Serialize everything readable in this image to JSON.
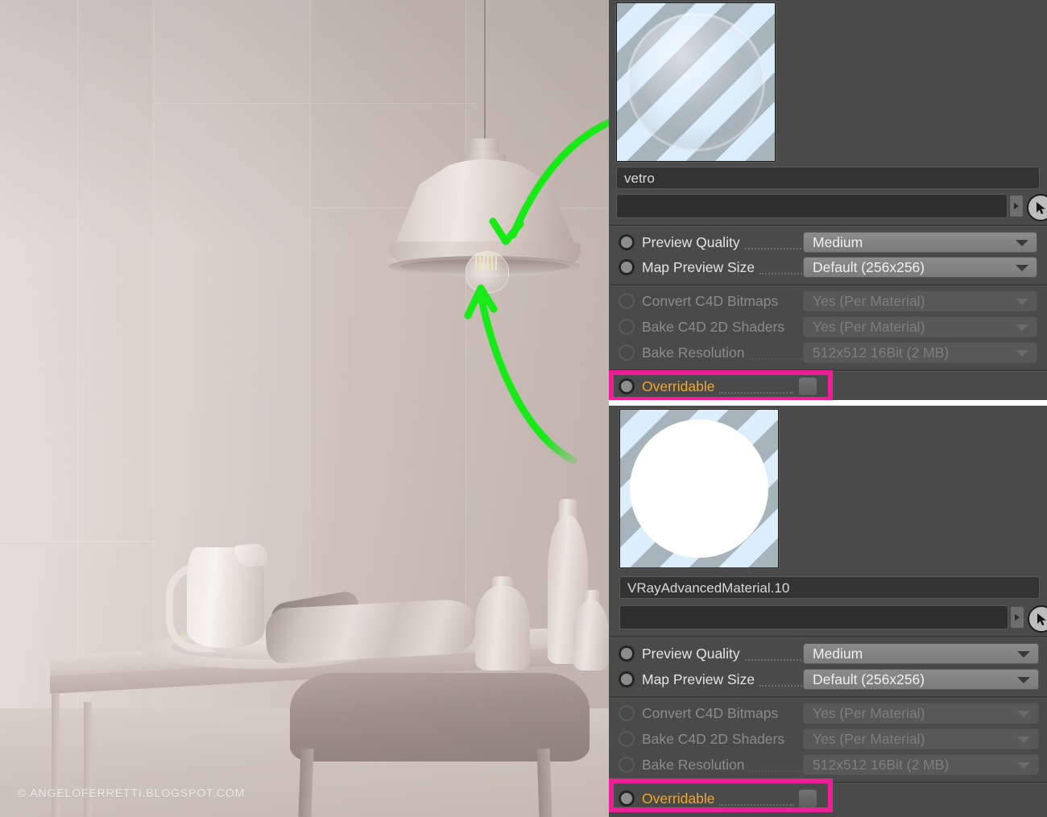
{
  "render": {
    "watermark": "© ANGELOFERRETTI.BLOGSPOT.COM",
    "scene_description": "Grey clay-render interior: pendant lamp with glass bulb over a table with pitcher, plate, cloth and vases, chair in foreground",
    "annotations": [
      {
        "name": "arrow-to-lamp-glass",
        "color": "#1eea1e",
        "from": "material-swatch-vetro",
        "to": "lamp-bulb-glass"
      },
      {
        "name": "arrow-to-bulb",
        "color": "#1eea1e",
        "from": "material-panel-vray-advanced",
        "to": "lamp-bulb"
      }
    ]
  },
  "highlight_color": "#ed1e96",
  "accent_color": "#f0a830",
  "materials": [
    {
      "id": "vetro",
      "swatch": "glass-sphere-preview",
      "name_value": "vetro",
      "link_value": "",
      "cursor_icon": "pick-cursor-icon",
      "properties": [
        {
          "label": "Preview Quality",
          "value": "Medium",
          "enabled": true,
          "control": "dropdown"
        },
        {
          "label": "Map Preview Size",
          "value": "Default (256x256)",
          "enabled": true,
          "control": "dropdown"
        },
        {
          "label": "Convert C4D Bitmaps",
          "value": "Yes (Per Material)",
          "enabled": false,
          "control": "dropdown"
        },
        {
          "label": "Bake C4D 2D Shaders",
          "value": "Yes (Per Material)",
          "enabled": false,
          "control": "dropdown"
        },
        {
          "label": "Bake Resolution",
          "value": "512x512   16Bit   (2 MB)",
          "enabled": false,
          "control": "dropdown"
        }
      ],
      "overridable": {
        "label": "Overridable",
        "checked": false,
        "highlighted": true
      }
    },
    {
      "id": "vray-advanced-material-10",
      "swatch": "white-sphere-preview",
      "name_value": "VRayAdvancedMaterial.10",
      "link_value": "",
      "cursor_icon": "pick-cursor-icon",
      "properties": [
        {
          "label": "Preview Quality",
          "value": "Medium",
          "enabled": true,
          "control": "dropdown"
        },
        {
          "label": "Map Preview Size",
          "value": "Default (256x256)",
          "enabled": true,
          "control": "dropdown"
        },
        {
          "label": "Convert C4D Bitmaps",
          "value": "Yes (Per Material)",
          "enabled": false,
          "control": "dropdown"
        },
        {
          "label": "Bake C4D 2D Shaders",
          "value": "Yes (Per Material)",
          "enabled": false,
          "control": "dropdown"
        },
        {
          "label": "Bake Resolution",
          "value": "512x512   16Bit   (2 MB)",
          "enabled": false,
          "control": "dropdown"
        }
      ],
      "overridable": {
        "label": "Overridable",
        "checked": false,
        "highlighted": true
      }
    }
  ]
}
